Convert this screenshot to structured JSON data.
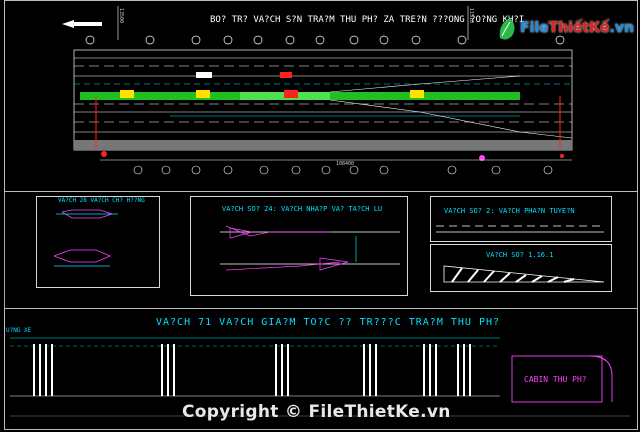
{
  "top_title": "BO? TR? VA?CH S?N TRA?M THU PH? ZA TRE?N ???ONG ?O?NG KH?I",
  "north_arrow": "",
  "top_dims": {
    "left": "13500",
    "middle": "108400",
    "right": "11510"
  },
  "panel_titles": {
    "chi_huong": "VA?CH 28 VA?CH CH? H??NG",
    "nhap_tach": "VA?CH SO? 24: VA?CH NHA?P VA? TA?CH LU",
    "phan_tuyen": "VA?CH SO? 2: VA?CH PHA?N TUYE?N",
    "so_116": "VA?CH SO? 1.16.1"
  },
  "bottom_title": "VA?CH 71 VA?CH GIA?M TO?C ?? TR???C TRA?M THU PH?",
  "bottom_left_label": "U?NG XE",
  "cabin_label": "CABIN THU PH?",
  "logo": {
    "file": "File",
    "thietke": "ThiếtKế",
    "vn": ".vn"
  },
  "copyright": "Copyright © FileThietKe.vn",
  "colors": {
    "bg": "#000000",
    "line": "#ffffff",
    "cyan": "#00e0ff",
    "magenta": "#ff40ff",
    "green": "#20e020",
    "yellow": "#ffe000",
    "red": "#ff2020"
  }
}
